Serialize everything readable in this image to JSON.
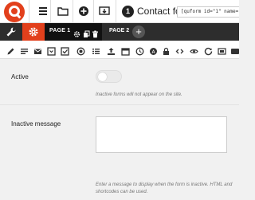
{
  "topbar": {
    "icons": [
      "logo-icon",
      "menu-icon",
      "folder-icon",
      "add-icon",
      "preview-icon"
    ],
    "form_number": "1",
    "form_title": "Contact form",
    "shortcode": "[quform id=\"1\" name=\"Contact"
  },
  "tabs": {
    "page1_label": "PAGE 1",
    "page2_label": "PAGE 2",
    "add_label": "+"
  },
  "field_icons": [
    "pencil-icon",
    "textarea-icon",
    "email-icon",
    "select-icon",
    "checkbox-icon",
    "radio-icon",
    "list-icon",
    "file-icon",
    "date-icon",
    "time-icon",
    "captcha-icon",
    "password-icon",
    "html-icon",
    "hidden-icon",
    "recaptcha-icon",
    "group-icon",
    "submit-icon"
  ],
  "settings": {
    "active_label": "Active",
    "active_help": "Inactive forms will not appear on the site.",
    "inactive_message_label": "Inactive message",
    "inactive_message_value": "",
    "inactive_message_help_line1": "Enter a message to display when the form is inactive. HTML and",
    "inactive_message_help_line2": "shortcodes can be used."
  },
  "colors": {
    "accent": "#e2401c",
    "dark_bar": "#2d2d2d"
  }
}
